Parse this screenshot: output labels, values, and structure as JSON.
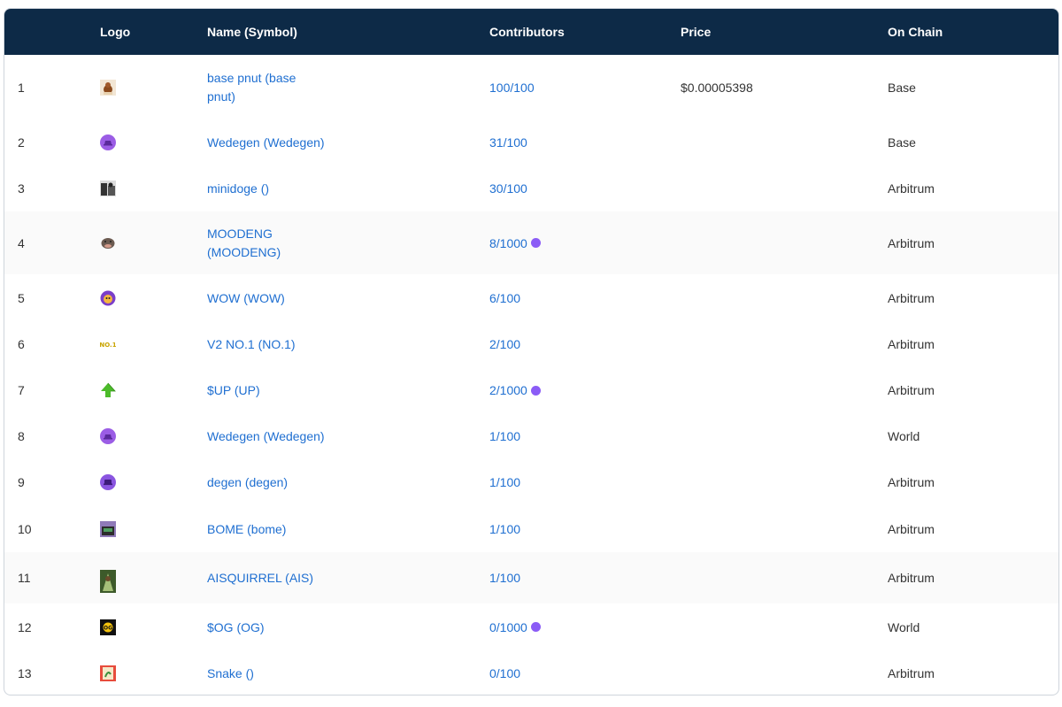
{
  "header": {
    "col_logo": "Logo",
    "col_name": "Name (Symbol)",
    "col_contributors": "Contributors",
    "col_price": "Price",
    "col_chain": "On Chain"
  },
  "rows": [
    {
      "index": "1",
      "logo_icon": "pnut-squirrel-icon",
      "name": "base pnut (base pnut)",
      "contributors": "100/100",
      "degen_badge": false,
      "price": "$0.00005398",
      "chain": "Base"
    },
    {
      "index": "2",
      "logo_icon": "wedegen-hat-icon",
      "name": "Wedegen (Wedegen)",
      "contributors": "31/100",
      "degen_badge": false,
      "price": "",
      "chain": "Base"
    },
    {
      "index": "3",
      "logo_icon": "minidoge-icon",
      "name": "minidoge ()",
      "contributors": "30/100",
      "degen_badge": false,
      "price": "",
      "chain": "Arbitrum"
    },
    {
      "index": "4",
      "logo_icon": "moodeng-hippo-icon",
      "name": "MOODENG (MOODENG)",
      "contributors": "8/1000",
      "degen_badge": true,
      "price": "",
      "chain": "Arbitrum"
    },
    {
      "index": "5",
      "logo_icon": "wow-icon",
      "name": "WOW (WOW)",
      "contributors": "6/100",
      "degen_badge": false,
      "price": "",
      "chain": "Arbitrum"
    },
    {
      "index": "6",
      "logo_icon": "no1-icon",
      "name": "V2 NO.1 (NO.1)",
      "contributors": "2/100",
      "degen_badge": false,
      "price": "",
      "chain": "Arbitrum"
    },
    {
      "index": "7",
      "logo_icon": "green-up-arrow-icon",
      "name": "$UP (UP)",
      "contributors": "2/1000",
      "degen_badge": true,
      "price": "",
      "chain": "Arbitrum"
    },
    {
      "index": "8",
      "logo_icon": "wedegen-hat-icon",
      "name": "Wedegen (Wedegen)",
      "contributors": "1/100",
      "degen_badge": false,
      "price": "",
      "chain": "World"
    },
    {
      "index": "9",
      "logo_icon": "degen-hat-icon",
      "name": "degen (degen)",
      "contributors": "1/100",
      "degen_badge": false,
      "price": "",
      "chain": "Arbitrum"
    },
    {
      "index": "10",
      "logo_icon": "bome-icon",
      "name": "BOME (bome)",
      "contributors": "1/100",
      "degen_badge": false,
      "price": "",
      "chain": "Arbitrum"
    },
    {
      "index": "11",
      "logo_icon": "aisquirrel-icon",
      "name": "AISQUIRREL (AIS)",
      "contributors": "1/100",
      "degen_badge": false,
      "price": "",
      "chain": "Arbitrum"
    },
    {
      "index": "12",
      "logo_icon": "og-icon",
      "name": "$OG (OG)",
      "contributors": "0/1000",
      "degen_badge": true,
      "price": "",
      "chain": "World"
    },
    {
      "index": "13",
      "logo_icon": "snake-icon",
      "name": "Snake ()",
      "contributors": "0/100",
      "degen_badge": false,
      "price": "",
      "chain": "Arbitrum"
    }
  ],
  "colors": {
    "header_bg": "#0d2a47",
    "link": "#1f6fd1",
    "degen_purple": "#8b5cf6"
  }
}
